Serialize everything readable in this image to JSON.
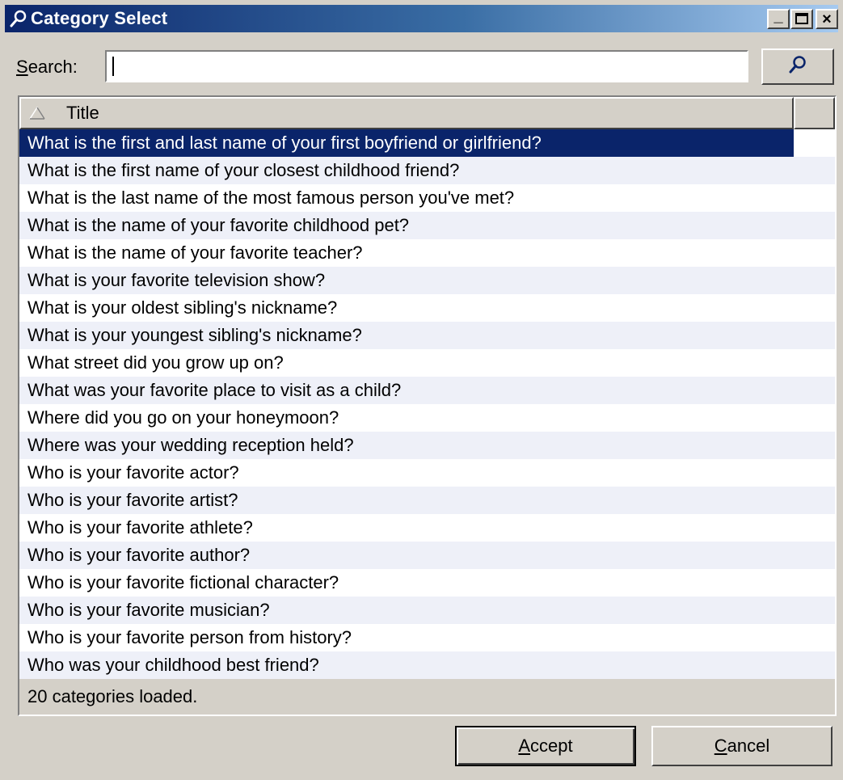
{
  "window": {
    "title": "Category Select",
    "minimize_glyph": "_",
    "maximize_glyph": "□",
    "close_glyph": "×"
  },
  "search": {
    "label_accel": "S",
    "label_rest": "earch:",
    "value": "",
    "placeholder": "",
    "button_icon": "search-icon"
  },
  "list": {
    "column_title": "Title",
    "sort_icon": "sort-ascending-icon",
    "selected_index": 0,
    "rows": [
      "What is the first and last name of your first boyfriend or girlfriend?",
      "What is the first name of your closest childhood friend?",
      "What is the last name of the most famous person you've met?",
      "What is the name of your favorite childhood pet?",
      "What is the name of your favorite teacher?",
      "What is your favorite television show?",
      "What is your oldest sibling's nickname?",
      "What is your youngest sibling's nickname?",
      "What street did you grow up on?",
      "What was your favorite place to visit as a child?",
      "Where did you go on your honeymoon?",
      "Where was your wedding reception held?",
      "Who is your favorite actor?",
      "Who is your favorite artist?",
      "Who is your favorite athlete?",
      "Who is your favorite author?",
      "Who is your favorite fictional character?",
      "Who is your favorite musician?",
      "Who is your favorite person from history?",
      "Who was your childhood best friend?"
    ],
    "status": "20 categories loaded."
  },
  "buttons": {
    "accept_accel": "A",
    "accept_rest": "ccept",
    "cancel_accel": "C",
    "cancel_rest": "ancel"
  },
  "colors": {
    "selection": "#0a246a",
    "alt_row": "#eef0f8",
    "face": "#d4d0c8"
  }
}
